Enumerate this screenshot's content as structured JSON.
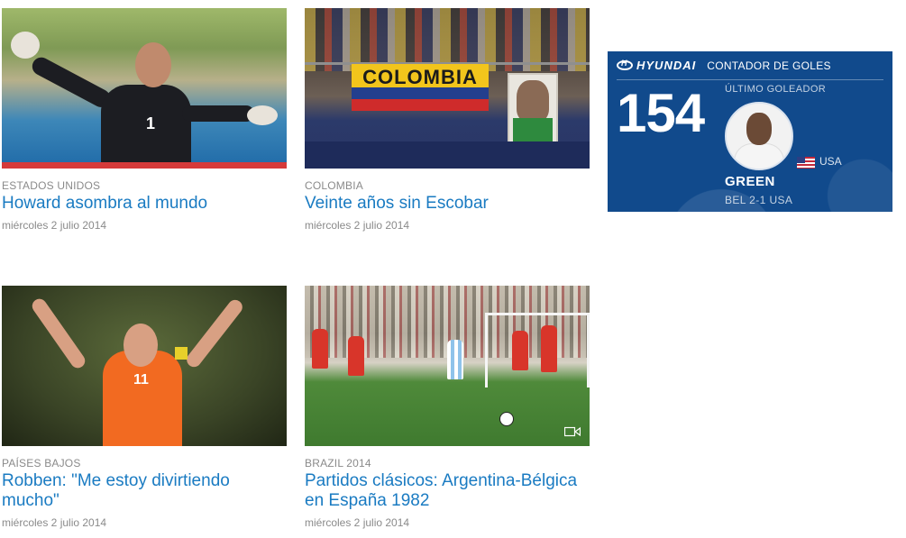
{
  "articles": [
    {
      "category": "ESTADOS UNIDOS",
      "headline": "Howard asombra al mundo",
      "date": "miércoles 2 julio 2014"
    },
    {
      "category": "COLOMBIA",
      "headline": "Veinte años sin Escobar",
      "date": "miércoles 2 julio 2014",
      "image_text": "COLOMBIA"
    },
    {
      "category": "PAÍSES BAJOS",
      "headline": "Robben: \"Me estoy divirtiendo mucho\"",
      "date": "miércoles 2 julio 2014"
    },
    {
      "category": "BRAZIL 2014",
      "headline": "Partidos clásicos: Argentina-Bélgica en España 1982",
      "date": "miércoles 2 julio 2014",
      "media_icon": "video-icon"
    }
  ],
  "goal_counter": {
    "sponsor": "HYUNDAI",
    "title": "CONTADOR DE GOLES",
    "count": "154",
    "last_scorer_label": "ÚLTIMO GOLEADOR",
    "player": "GREEN",
    "country": "USA",
    "match": "BEL  2-1  USA"
  },
  "colors": {
    "link": "#1a7bc2",
    "meta": "#8a8a8a",
    "widget_bg": "#114a8c"
  }
}
